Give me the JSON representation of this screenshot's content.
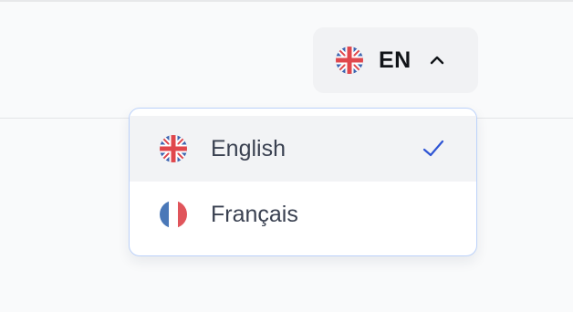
{
  "language_switcher": {
    "current_code": "EN",
    "current_flag_icon": "uk-flag-icon",
    "toggle_icon": "chevron-up-icon",
    "options": [
      {
        "label": "English",
        "flag_icon": "uk-flag-icon",
        "selected": true
      },
      {
        "label": "Français",
        "flag_icon": "france-flag-icon",
        "selected": false
      }
    ],
    "selected_indicator_icon": "checkmark-icon"
  },
  "colors": {
    "accent": "#2f55d4",
    "dropdown_border": "#bcd2fa",
    "selected_row_bg": "#f2f3f5",
    "uk_red": "#e0474c",
    "uk_blue": "#3f65b0",
    "fr_blue": "#4a78b8",
    "fr_red": "#e0555b"
  }
}
